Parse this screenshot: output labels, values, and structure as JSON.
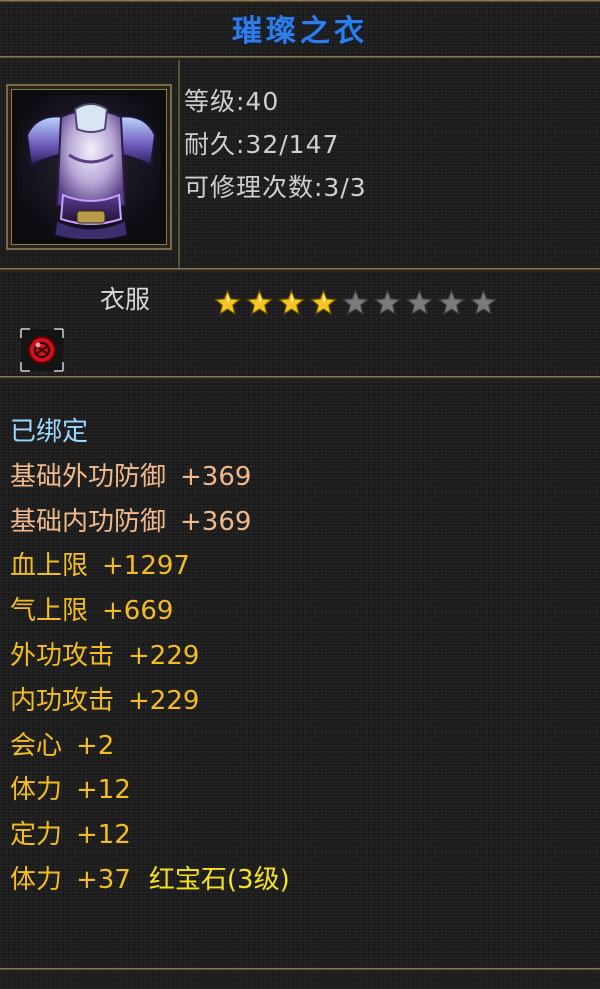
{
  "item": {
    "name": "璀璨之衣",
    "level_line": "等级:40",
    "durability_line": "耐久:32/147",
    "repair_line": "可修理次数:3/3",
    "category": "衣服",
    "star_rating": {
      "filled": 4,
      "total": 9
    },
    "icon": "armor-chest-icon",
    "socket_icon": "red-gem-socket-icon"
  },
  "attributes": {
    "bound": "已绑定",
    "rows": [
      {
        "label": "基础外功防御",
        "value": "+369"
      },
      {
        "label": "基础内功防御",
        "value": "+369"
      },
      {
        "label": "血上限",
        "value": "+1297"
      },
      {
        "label": "气上限",
        "value": "+669"
      },
      {
        "label": "外功攻击",
        "value": "+229"
      },
      {
        "label": "内功攻击",
        "value": "+229"
      },
      {
        "label": "会心",
        "value": "+2"
      },
      {
        "label": "体力",
        "value": "+12"
      },
      {
        "label": "定力",
        "value": "+12"
      },
      {
        "label": "体力",
        "value": "+37",
        "gem": "红宝石(3级)"
      }
    ]
  },
  "colors": {
    "title": "#2f7ee8",
    "bound": "#9ad8ff",
    "base_defense": "#f0b98c",
    "attribute": "#f3bd1f",
    "gem": "#f7e21c",
    "star_filled": "#f5c526",
    "star_empty": "#7a7a7a",
    "border": "#7a6a4a"
  }
}
